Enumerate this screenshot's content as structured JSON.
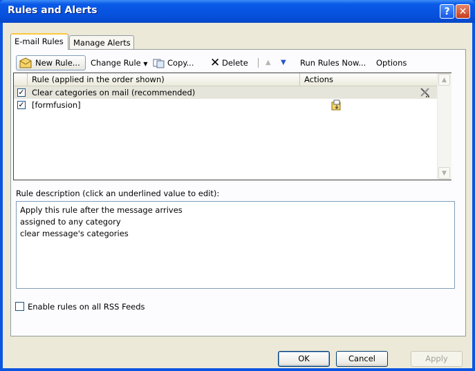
{
  "window": {
    "title": "Rules and Alerts"
  },
  "tabs": [
    {
      "label": "E-mail Rules",
      "active": true
    },
    {
      "label": "Manage Alerts",
      "active": false
    }
  ],
  "toolbar": {
    "new_rule": "New Rule...",
    "change_rule": "Change Rule",
    "copy": "Copy...",
    "delete": "Delete",
    "run_rules_now": "Run Rules Now...",
    "options": "Options"
  },
  "rules_list": {
    "columns": [
      "Rule (applied in the order shown)",
      "Actions"
    ],
    "rows": [
      {
        "name": "Clear categories on mail (recommended)",
        "checked": true,
        "selected": true,
        "action_icon": "tools-icon"
      },
      {
        "name": "[formfusion]",
        "checked": true,
        "selected": false,
        "action_icon": "move-to-folder-icon"
      }
    ]
  },
  "description": {
    "label": "Rule description (click an underlined value to edit):",
    "lines": [
      "Apply this rule after the message arrives",
      "assigned to any category",
      "clear message's categories"
    ]
  },
  "rss": {
    "label": "Enable rules on all RSS Feeds",
    "checked": false
  },
  "buttons": {
    "ok": "OK",
    "cancel": "Cancel",
    "apply": "Apply"
  },
  "colors": {
    "titlebar": "#0650dc",
    "tab_highlight": "#ffc83c",
    "dialog_bg": "#ece9d8"
  }
}
